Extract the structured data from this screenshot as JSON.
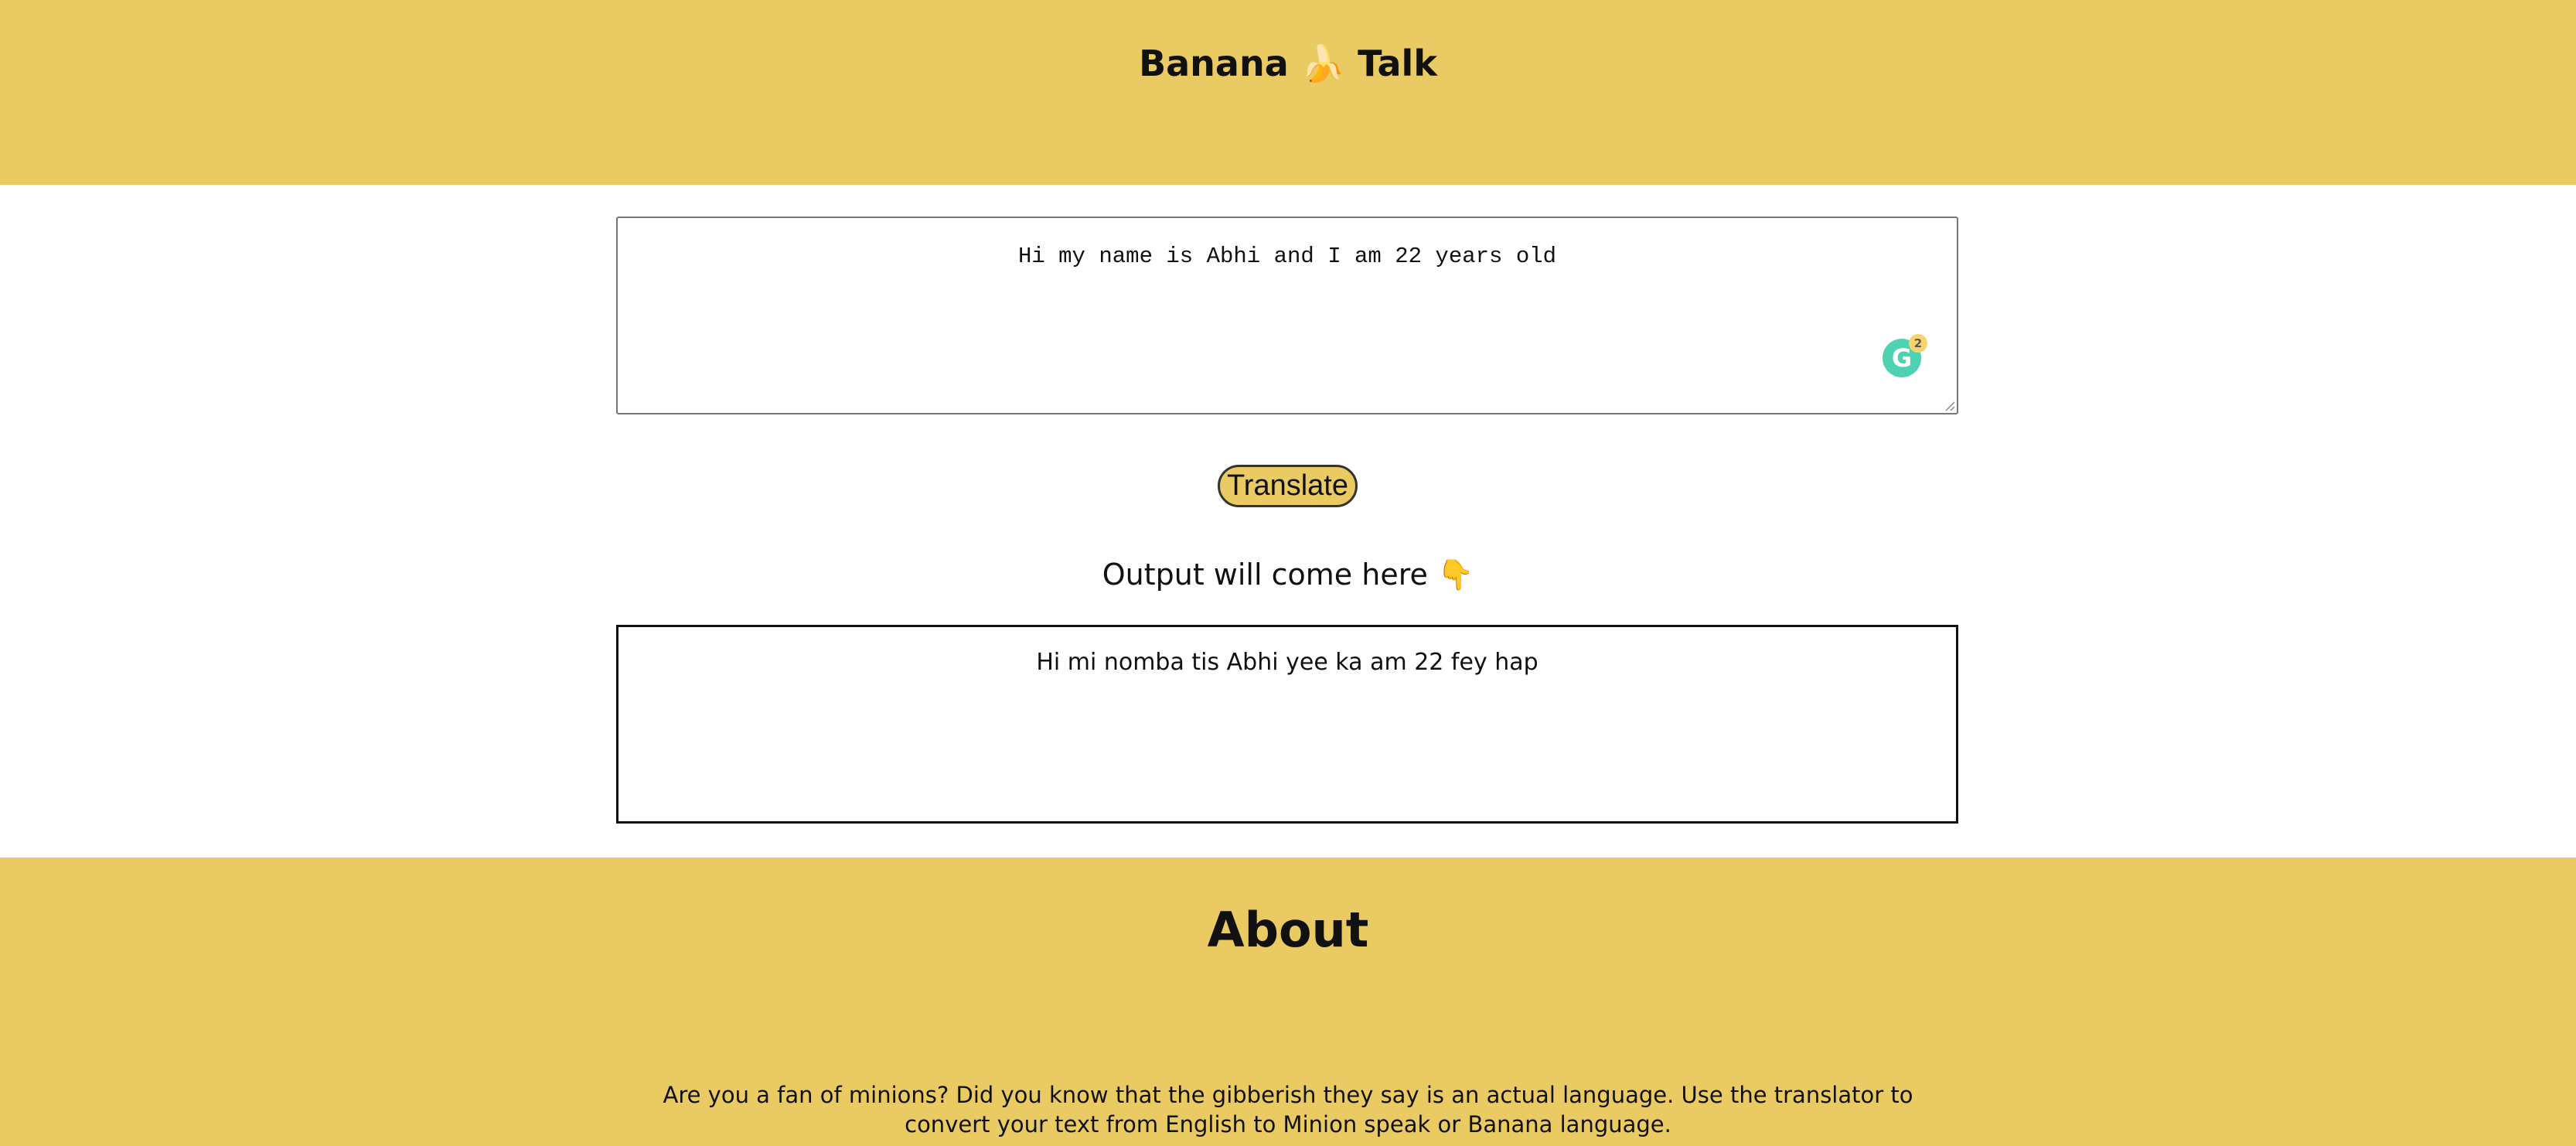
{
  "header": {
    "title_left": "Banana",
    "title_emoji": "🍌",
    "title_right": "Talk"
  },
  "input": {
    "value": "Hi my name is Abhi and I am 22 years old",
    "grammarly_count": "2"
  },
  "translate_button": {
    "label": "Translate"
  },
  "output": {
    "label": "Output will come here 👇",
    "value": "Hi mi nomba tis Abhi yee ka am 22 fey hap"
  },
  "about": {
    "title": "About",
    "description": "Are you a fan of minions? Did you know that the gibberish they say is an actual language. Use the translator to convert your text from English to Minion speak or Banana language."
  },
  "colors": {
    "accent": "#EACA62",
    "grammarly": "#15C39A",
    "text": "#111111"
  }
}
